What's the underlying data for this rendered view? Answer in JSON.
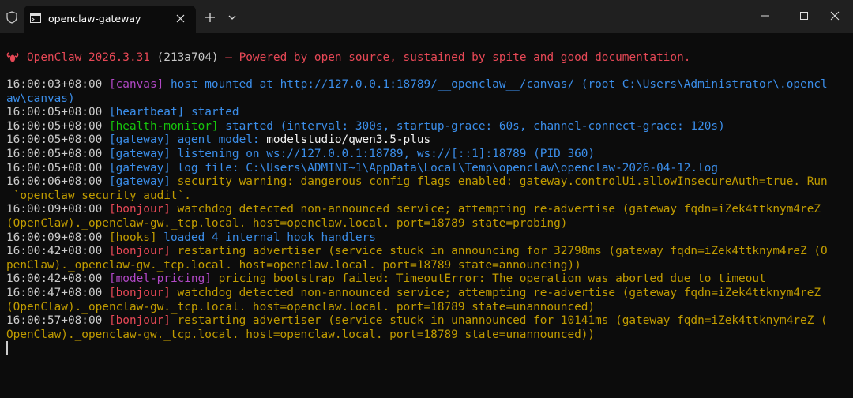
{
  "window": {
    "tab_title": "openclaw-gateway",
    "colors": {
      "titlebar": "#202020",
      "terminal_bg": "#0c0c0c"
    }
  },
  "banner": {
    "brand": "OpenClaw 2026.3.31",
    "hash": "(213a704)",
    "tagline": " — Powered by open source, sustained by spite and good documentation."
  },
  "log": [
    {
      "ts": "16:00:03+08:00",
      "tag": "[canvas]",
      "msg": "host mounted at http://127.0.0.1:18789/__openclaw__/canvas/ (root C:\\Users\\Administrator\\.opencl",
      "cont": "aw\\canvas)"
    },
    {
      "ts": "16:00:05+08:00",
      "tag": "[heartbeat]",
      "msg": "started"
    },
    {
      "ts": "16:00:05+08:00",
      "tag": "[health-monitor]",
      "msg": "started (interval: 300s, startup-grace: 60s, channel-connect-grace: 120s)"
    },
    {
      "ts": "16:00:05+08:00",
      "tag": "[gateway]",
      "msg": "agent model: ",
      "value": "modelstudio/qwen3.5-plus"
    },
    {
      "ts": "16:00:05+08:00",
      "tag": "[gateway]",
      "msg": "listening on ws://127.0.0.1:18789, ws://[::1]:18789 (PID 360)"
    },
    {
      "ts": "16:00:05+08:00",
      "tag": "[gateway]",
      "msg": "log file: C:\\Users\\ADMINI~1\\AppData\\Local\\Temp\\openclaw\\openclaw-2026-04-12.log"
    },
    {
      "ts": "16:00:06+08:00",
      "tag": "[gateway]",
      "msg": "security warning: dangerous config flags enabled: gateway.controlUi.allowInsecureAuth=true. Run",
      "cont": " `openclaw security audit`."
    },
    {
      "ts": "16:00:09+08:00",
      "tag": "[bonjour]",
      "msg": "watchdog detected non-announced service; attempting re-advertise (gateway fqdn=iZek4ttknym4reZ",
      "cont": "(OpenClaw)._openclaw-gw._tcp.local. host=openclaw.local. port=18789 state=probing)"
    },
    {
      "ts": "16:00:09+08:00",
      "tag": "[hooks]",
      "msg": "loaded 4 internal hook handlers"
    },
    {
      "ts": "16:00:42+08:00",
      "tag": "[bonjour]",
      "msg": "restarting advertiser (service stuck in announcing for 32798ms (gateway fqdn=iZek4ttknym4reZ (O",
      "cont": "penClaw)._openclaw-gw._tcp.local. host=openclaw.local. port=18789 state=announcing))"
    },
    {
      "ts": "16:00:42+08:00",
      "tag": "[model-pricing]",
      "msg": "pricing bootstrap failed: TimeoutError: The operation was aborted due to timeout"
    },
    {
      "ts": "16:00:47+08:00",
      "tag": "[bonjour]",
      "msg": "watchdog detected non-announced service; attempting re-advertise (gateway fqdn=iZek4ttknym4reZ",
      "cont": "(OpenClaw)._openclaw-gw._tcp.local. host=openclaw.local. port=18789 state=unannounced)"
    },
    {
      "ts": "16:00:57+08:00",
      "tag": "[bonjour]",
      "msg": "restarting advertiser (service stuck in unannounced for 10141ms (gateway fqdn=iZek4ttknym4reZ (",
      "cont": "OpenClaw)._openclaw-gw._tcp.local. host=openclaw.local. port=18789 state=unannounced))"
    }
  ]
}
